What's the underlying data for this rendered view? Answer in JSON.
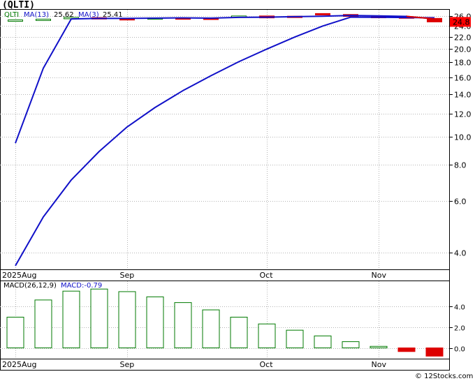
{
  "title": "(QLTI)",
  "credit": "© 12Stocks.com",
  "colors": {
    "ma": "#1010c8",
    "up": "#007a00",
    "down": "#dd0000",
    "grid": "#b4b4b4",
    "price_badge": "#ff0000"
  },
  "chart_data": [
    {
      "type": "candlestick",
      "legend": {
        "symbol": "QLTI",
        "ma13_label": "MA(13)",
        "ma13_value": "25.62",
        "ma3_label": "MA(3)",
        "ma3_value": "25.41"
      },
      "price_badge": "24.8",
      "y_scale": "log",
      "ylim": [
        3.5,
        27
      ],
      "y_ticks": [
        {
          "value": 4.0,
          "label": "4.0"
        },
        {
          "value": 6.0,
          "label": "6.0"
        },
        {
          "value": 8.0,
          "label": "8.0"
        },
        {
          "value": 10.0,
          "label": "10.0"
        },
        {
          "value": 12.0,
          "label": "12.0"
        },
        {
          "value": 14.0,
          "label": "14.0"
        },
        {
          "value": 16.0,
          "label": "16.0"
        },
        {
          "value": 18.0,
          "label": "18.0"
        },
        {
          "value": 20.0,
          "label": "20.0"
        },
        {
          "value": 22.0,
          "label": "22.0"
        },
        {
          "value": 24.0,
          "label": "24.0"
        },
        {
          "value": 26.0,
          "label": "26.0"
        }
      ],
      "x_labels": [
        {
          "label": "2025Aug",
          "index": 0
        },
        {
          "label": "Sep",
          "index": 4
        },
        {
          "label": "Oct",
          "index": 9
        },
        {
          "label": "Nov",
          "index": 13
        }
      ],
      "candles": [
        {
          "open": 25.15,
          "close": 25.2,
          "high": 25.25,
          "low": 25.1
        },
        {
          "open": 25.1,
          "close": 25.35,
          "high": 25.4,
          "low": 25.05
        },
        {
          "open": 25.45,
          "close": 25.7,
          "high": 25.75,
          "low": 25.4
        },
        {
          "open": 25.65,
          "close": 25.5,
          "high": 25.7,
          "low": 25.45
        },
        {
          "open": 25.45,
          "close": 25.3,
          "high": 25.5,
          "low": 25.25
        },
        {
          "open": 25.55,
          "close": 25.6,
          "high": 25.65,
          "low": 25.5
        },
        {
          "open": 25.6,
          "close": 25.55,
          "high": 25.65,
          "low": 25.5
        },
        {
          "open": 25.55,
          "close": 25.5,
          "high": 25.6,
          "low": 25.45
        },
        {
          "open": 25.7,
          "close": 26.0,
          "high": 26.05,
          "low": 25.65
        },
        {
          "open": 26.0,
          "close": 25.6,
          "high": 26.05,
          "low": 25.55
        },
        {
          "open": 25.95,
          "close": 25.9,
          "high": 26.0,
          "low": 25.85
        },
        {
          "open": 26.5,
          "close": 26.3,
          "high": 26.55,
          "low": 26.25
        },
        {
          "open": 26.3,
          "close": 25.9,
          "high": 26.35,
          "low": 25.85
        },
        {
          "open": 25.9,
          "close": 25.85,
          "high": 25.95,
          "low": 25.8
        },
        {
          "open": 25.8,
          "close": 25.75,
          "high": 26.1,
          "low": 25.7
        },
        {
          "open": 25.5,
          "close": 24.8,
          "high": 25.55,
          "low": 24.75
        }
      ],
      "series": [
        {
          "name": "MA(13)",
          "color": "#1010c8",
          "x": [
            0,
            1,
            2,
            3,
            4,
            5,
            6,
            7,
            8,
            9,
            10,
            11,
            12,
            13,
            14,
            15
          ],
          "values": [
            3.6,
            5.3,
            7.1,
            8.9,
            10.8,
            12.6,
            14.4,
            16.2,
            18.1,
            20.0,
            22.0,
            24.0,
            25.75,
            25.72,
            25.68,
            25.62
          ]
        },
        {
          "name": "MA(3)",
          "color": "#1010c8",
          "x": [
            0,
            1,
            2,
            3,
            4,
            5,
            6,
            7,
            8,
            9,
            10,
            11,
            12,
            13,
            14,
            15
          ],
          "values": [
            9.5,
            17.2,
            25.4,
            25.5,
            25.5,
            25.55,
            25.6,
            25.55,
            25.7,
            25.75,
            25.85,
            25.95,
            26.1,
            26.0,
            25.9,
            25.41
          ]
        }
      ]
    },
    {
      "type": "bar",
      "label": "MACD(26,12,9)",
      "value_label": "MACD:-0.79",
      "ylim": [
        -0.9,
        6.2
      ],
      "y_ticks": [
        {
          "value": 0.0,
          "label": "0.0"
        },
        {
          "value": 2.0,
          "label": "2.0"
        },
        {
          "value": 4.0,
          "label": "4.0"
        }
      ],
      "x_labels": [
        {
          "label": "2025Aug",
          "index": 0
        },
        {
          "label": "Sep",
          "index": 4
        },
        {
          "label": "Oct",
          "index": 9
        },
        {
          "label": "Nov",
          "index": 13
        }
      ],
      "values": [
        2.95,
        4.6,
        5.45,
        5.65,
        5.4,
        4.9,
        4.35,
        3.65,
        2.95,
        2.3,
        1.7,
        1.15,
        0.6,
        0.15,
        -0.35,
        -0.79
      ]
    }
  ]
}
